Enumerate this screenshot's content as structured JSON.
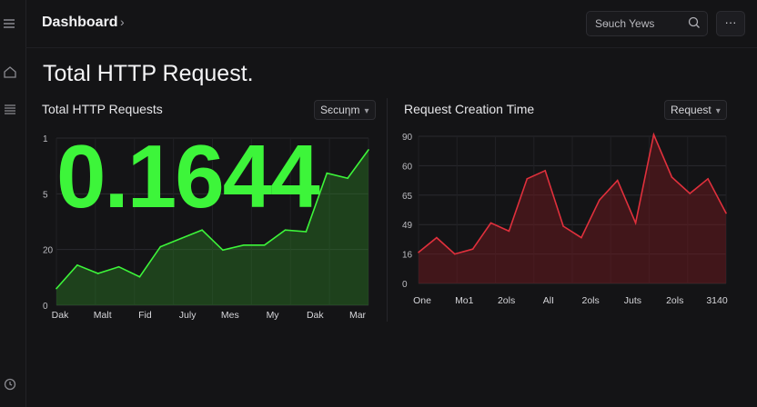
{
  "header": {
    "breadcrumb": "Dashboard",
    "search_placeholder": "Sѳuch Yews",
    "more_label": "···"
  },
  "page": {
    "title": "Total HTTP Request."
  },
  "left_card": {
    "title": "Total HTTP Requests",
    "dropdown": "Sєcuηm",
    "big_number": "0.1644"
  },
  "right_card": {
    "title": "Request Creation Time",
    "dropdown": "Request"
  },
  "colors": {
    "green": "#3df53a",
    "red": "#e0303c",
    "bg": "#141416"
  },
  "icons": [
    "menu-icon",
    "home-icon",
    "list-icon",
    "history-icon",
    "search-icon",
    "chevron-right-icon",
    "chevron-down-icon",
    "more-icon"
  ],
  "chart_data": [
    {
      "type": "area",
      "title": "Total HTTP Requests",
      "y_tick_labels": [
        "1",
        "5",
        "20",
        "0"
      ],
      "x_tick_labels": [
        "Dak",
        "Malt",
        "Fid",
        "July",
        "Mes",
        "My",
        "Dak",
        "Mar"
      ],
      "ylim": [
        0,
        100
      ],
      "values": [
        10,
        24,
        19,
        23,
        17,
        35,
        40,
        45,
        33,
        36,
        36,
        45,
        44,
        79,
        76,
        93
      ],
      "color": "#3df53a"
    },
    {
      "type": "area",
      "title": "Request Creation Time",
      "y_tick_labels": [
        "90",
        "60",
        "65",
        "49",
        "16",
        "0"
      ],
      "x_tick_labels": [
        "One",
        "Mo1",
        "2ols",
        "AlI",
        "2ols",
        "Juts",
        "2ols",
        "3140"
      ],
      "ylim": [
        0,
        90
      ],
      "values": [
        19,
        28,
        18,
        21,
        37,
        32,
        64,
        69,
        35,
        28,
        51,
        63,
        37,
        91,
        65,
        55,
        64,
        43
      ],
      "color": "#e0303c"
    }
  ]
}
